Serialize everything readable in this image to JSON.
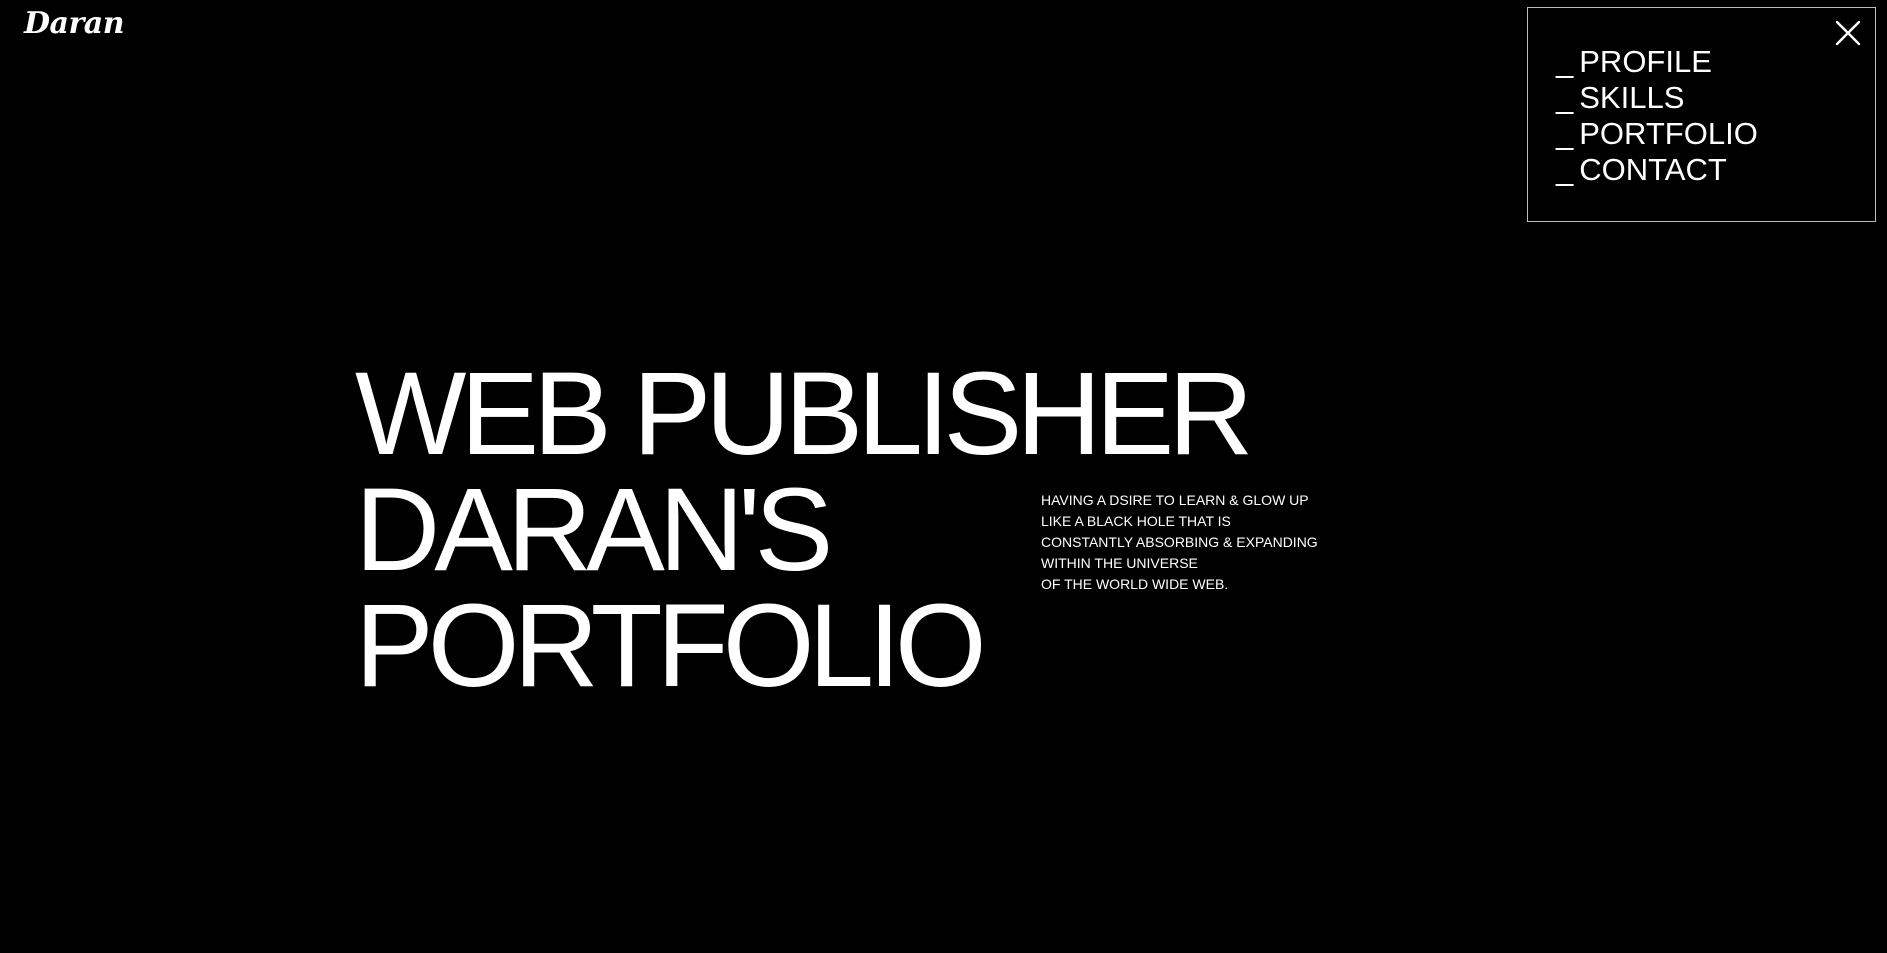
{
  "header": {
    "logo_text": "Daran"
  },
  "menu": {
    "close_icon": "close-icon",
    "items": [
      {
        "prefix": "_",
        "label": "PROFILE"
      },
      {
        "prefix": "_",
        "label": "SKILLS"
      },
      {
        "prefix": "_",
        "label": "PORTFOLIO"
      },
      {
        "prefix": "_",
        "label": "CONTACT"
      }
    ]
  },
  "hero": {
    "lines": [
      "WEB PUBLISHER",
      "DARAN'S",
      "PORTFOLIO"
    ]
  },
  "tagline": {
    "lines": [
      "HAVING A DSIRE TO LEARN & GLOW UP",
      "LIKE A BLACK HOLE THAT IS",
      "CONSTANTLY ABSORBING & EXPANDING",
      "WITHIN THE UNIVERSE",
      "OF THE WORLD WIDE WEB."
    ]
  },
  "colors": {
    "background": "#000000",
    "text": "#ffffff",
    "panel_border": "#bdbdbd"
  }
}
